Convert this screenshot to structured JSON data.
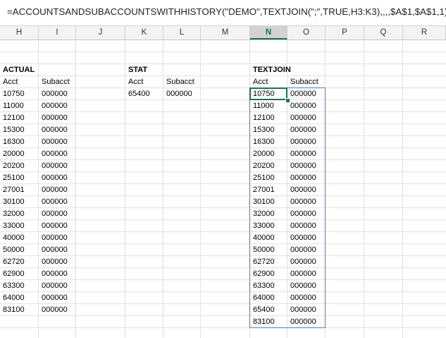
{
  "formula": "=ACCOUNTSANDSUBACCOUNTSWITHHISTORY(\"DEMO\",TEXTJOIN(\";\",TRUE,H3:K3),,,,$A$1,$A$1,1)",
  "columns": [
    "H",
    "I",
    "J",
    "K",
    "L",
    "M",
    "N",
    "O",
    "P",
    "Q",
    "R"
  ],
  "selected_column": "N",
  "actual": {
    "title": "ACTUAL",
    "acct_header": "Acct",
    "subacct_header": "Subacct",
    "accts": [
      "10750",
      "11000",
      "12100",
      "15300",
      "16300",
      "20000",
      "20200",
      "25100",
      "27001",
      "30100",
      "32000",
      "33000",
      "40000",
      "50000",
      "62720",
      "62900",
      "63300",
      "64000",
      "83100"
    ],
    "subaccts": [
      "000000",
      "000000",
      "000000",
      "000000",
      "000000",
      "000000",
      "000000",
      "000000",
      "000000",
      "000000",
      "000000",
      "000000",
      "000000",
      "000000",
      "000000",
      "000000",
      "000000",
      "000000",
      "000000"
    ]
  },
  "stat": {
    "title": "STAT",
    "acct_header": "Acct",
    "subacct_header": "Subacct",
    "accts": [
      "65400"
    ],
    "subaccts": [
      "000000"
    ]
  },
  "textjoin": {
    "title": "TEXTJOIN",
    "acct_header": "Acct",
    "subacct_header": "Subacct",
    "accts": [
      "10750",
      "11000",
      "12100",
      "15300",
      "16300",
      "20000",
      "20200",
      "25100",
      "27001",
      "30100",
      "32000",
      "33000",
      "40000",
      "50000",
      "62720",
      "62900",
      "63300",
      "64000",
      "65400",
      "83100"
    ],
    "subaccts": [
      "000000",
      "000000",
      "000000",
      "000000",
      "000000",
      "000000",
      "000000",
      "000000",
      "000000",
      "000000",
      "000000",
      "000000",
      "000000",
      "000000",
      "000000",
      "000000",
      "000000",
      "000000",
      "000000",
      "000000"
    ]
  },
  "colors": {
    "selection_green": "#217346",
    "spill_border_blue": "#4a7ebb",
    "gridline": "#e1e1e1"
  }
}
